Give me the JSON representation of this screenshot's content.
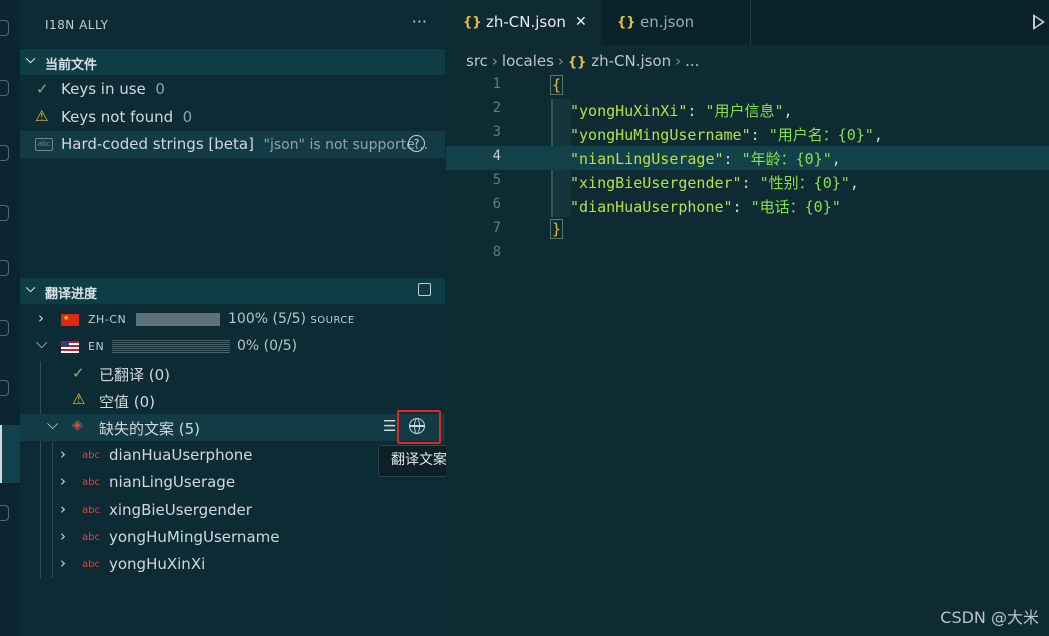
{
  "sidebar": {
    "title": "I18N ALLY",
    "more": "···",
    "current_file": {
      "header": "当前文件",
      "keys_in_use_label": "Keys in use",
      "keys_in_use_count": "0",
      "keys_not_found_label": "Keys not found",
      "keys_not_found_count": "0",
      "hardcoded_label": "Hard-coded strings [beta]",
      "hardcoded_desc": "\"json\" is not supporte..."
    },
    "progress": {
      "header": "翻译进度",
      "locales": [
        {
          "code": "ZH-CN",
          "percent": "100%",
          "ratio": "(5/5)",
          "tag": "SOURCE",
          "fill": 1.0
        },
        {
          "code": "EN",
          "percent": "0%",
          "ratio": "(0/5)",
          "tag": "",
          "fill": 0.0
        }
      ],
      "translated_label": "已翻译 (0)",
      "empty_label": "空值 (0)",
      "missing_label": "缺失的文案 (5)",
      "missing_keys": [
        "dianHuaUserphone",
        "nianLingUserage",
        "xingBieUsergender",
        "yongHuMingUsername",
        "yongHuXinXi"
      ],
      "abc": "abc",
      "tooltip": "翻译文案"
    }
  },
  "editor": {
    "tabs": [
      {
        "braces": "{}",
        "label": "zh-CN.json",
        "close": "✕"
      },
      {
        "braces": "{}",
        "label": "en.json"
      }
    ],
    "breadcrumb": {
      "parts": [
        "src",
        "locales"
      ],
      "file": "zh-CN.json",
      "more": "..."
    },
    "lines": [
      {
        "n": "1",
        "text": "{"
      },
      {
        "n": "2",
        "key": "\"yongHuXinXi\"",
        "val": "\"用户信息\"",
        "end": ","
      },
      {
        "n": "3",
        "key": "\"yongHuMingUsername\"",
        "val": "\"用户名：{0}\"",
        "end": ","
      },
      {
        "n": "4",
        "key": "\"nianLingUserage\"",
        "val": "\"年龄：{0}\"",
        "end": ","
      },
      {
        "n": "5",
        "key": "\"xingBieUsergender\"",
        "val": "\"性别：{0}\"",
        "end": ","
      },
      {
        "n": "6",
        "key": "\"dianHuaUserphone\"",
        "val": "\"电话：{0}\"",
        "end": ""
      },
      {
        "n": "7",
        "text": "}"
      },
      {
        "n": "8",
        "text": ""
      }
    ]
  },
  "watermark": "CSDN @大米"
}
